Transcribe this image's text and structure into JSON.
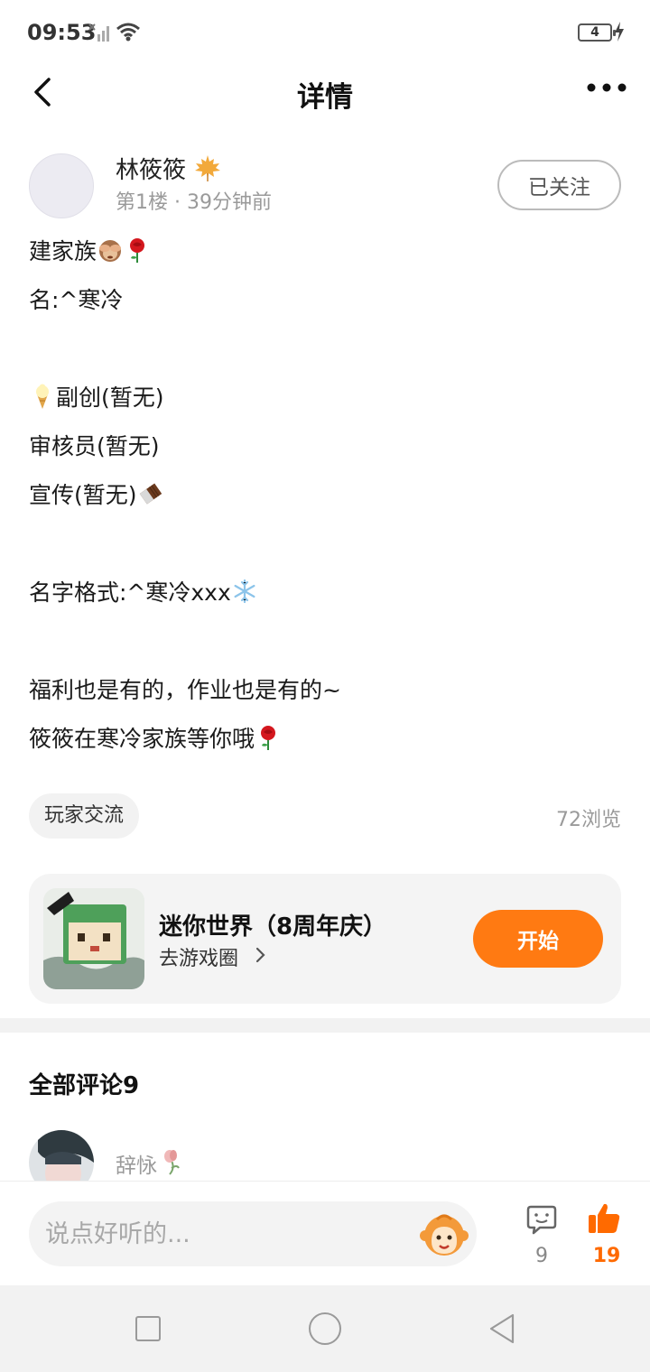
{
  "status_bar": {
    "time": "09:53",
    "battery": "4"
  },
  "header": {
    "title": "详情"
  },
  "post": {
    "author": "林筱筱",
    "floor_meta": "第1楼 · 39分钟前",
    "follow_label": "已关注",
    "lines": [
      "建家族",
      "名:^寒冷",
      "",
      "副创(暂无)",
      "审核员(暂无)",
      "宣传(暂无)",
      "",
      "名字格式:^寒冷xxx",
      "",
      "福利也是有的，作业也是有的~",
      "筱筱在寒冷家族等你哦"
    ],
    "tag": "玩家交流",
    "views": "72浏览"
  },
  "game_card": {
    "title": "迷你世界（8周年庆）",
    "subtitle": "去游戏圈",
    "start_label": "开始",
    "accent_color": "#ff7a12"
  },
  "comments": {
    "title": "全部评论9",
    "first_author": "辞怺"
  },
  "bottom_bar": {
    "input_placeholder": "说点好听的...",
    "comment_count": "9",
    "like_count": "19"
  }
}
